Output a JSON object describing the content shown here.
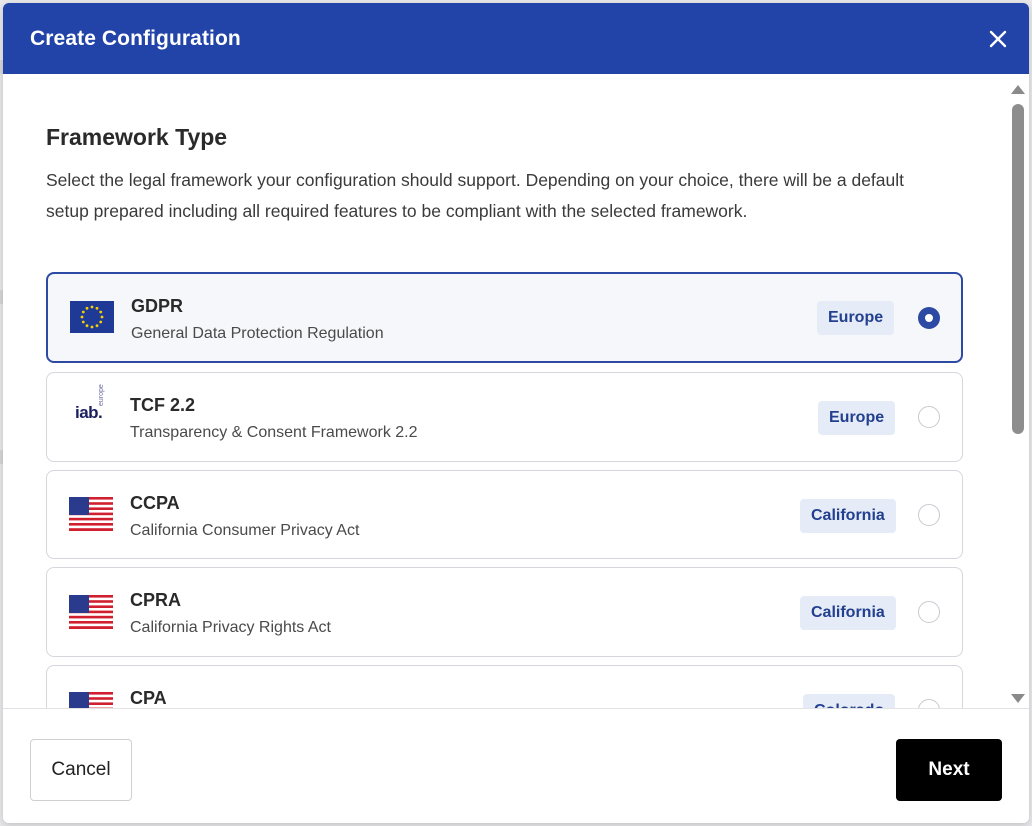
{
  "modal": {
    "title": "Create Configuration"
  },
  "section": {
    "title": "Framework Type",
    "description": "Select the legal framework your configuration should support. Depending on your choice, there will be a default setup prepared including all required features to be compliant with the selected framework."
  },
  "frameworks": [
    {
      "name": "GDPR",
      "full_name": "General Data Protection Regulation",
      "region": "Europe",
      "logo": "eu-flag-icon",
      "selected": true
    },
    {
      "name": "TCF 2.2",
      "full_name": "Transparency & Consent Framework 2.2",
      "region": "Europe",
      "logo": "iab-europe-logo",
      "logo_text": "iab.",
      "logo_subtext": "europe",
      "selected": false
    },
    {
      "name": "CCPA",
      "full_name": "California Consumer Privacy Act",
      "region": "California",
      "logo": "us-flag-icon",
      "selected": false
    },
    {
      "name": "CPRA",
      "full_name": "California Privacy Rights Act",
      "region": "California",
      "logo": "us-flag-icon",
      "selected": false
    },
    {
      "name": "CPA",
      "full_name": "",
      "region": "Colorado",
      "logo": "us-flag-icon",
      "selected": false
    }
  ],
  "footer": {
    "cancel_label": "Cancel",
    "next_label": "Next"
  },
  "colors": {
    "header": "#2244a8",
    "accent": "#2c4aa3",
    "badge_bg": "#e6ecf7",
    "badge_text": "#22408f"
  }
}
